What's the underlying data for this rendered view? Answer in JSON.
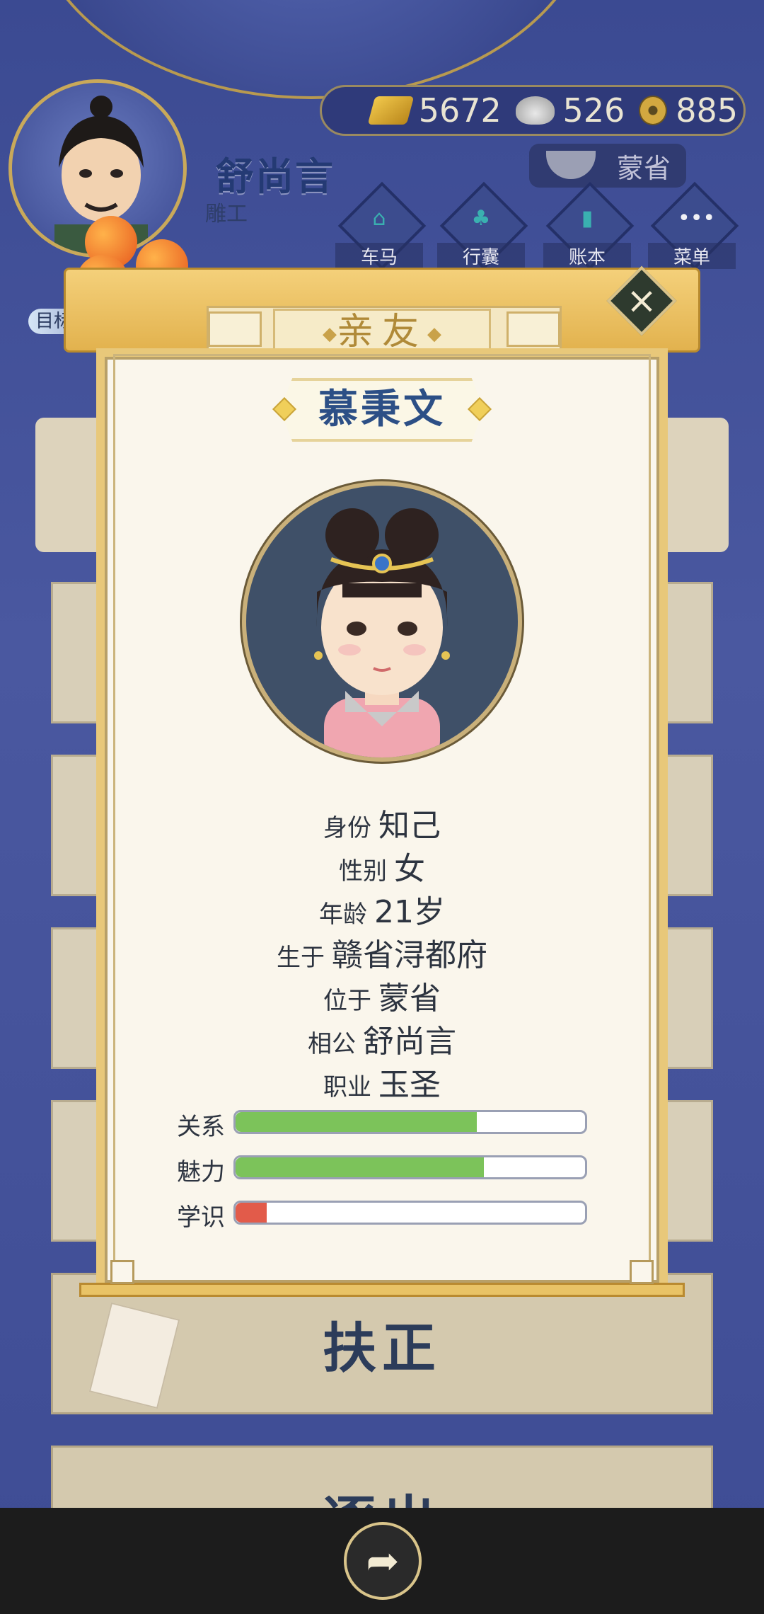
{
  "player": {
    "name": "舒尚言",
    "job": "雕工",
    "goal_label": "目标"
  },
  "resources": {
    "gold": "5672",
    "silver": "526",
    "coins": "885"
  },
  "location": {
    "label": "蒙省"
  },
  "menu": [
    {
      "label": "车马",
      "icon": "carriage-icon"
    },
    {
      "label": "行囊",
      "icon": "bundle-icon"
    },
    {
      "label": "账本",
      "icon": "ledger-icon"
    },
    {
      "label": "菜单",
      "icon": "more-icon"
    }
  ],
  "dialog": {
    "title": "亲友",
    "name": "慕秉文",
    "info": [
      {
        "key": "身份",
        "value": "知己"
      },
      {
        "key": "性别",
        "value": "女"
      },
      {
        "key": "年龄",
        "value": "21岁"
      },
      {
        "key": "生于",
        "value": "赣省浔都府"
      },
      {
        "key": "位于",
        "value": "蒙省"
      },
      {
        "key": "相公",
        "value": "舒尚言"
      },
      {
        "key": "职业",
        "value": "玉圣"
      }
    ],
    "stats": [
      {
        "label": "关系",
        "fraction": 0.69,
        "color": "#7cc35a"
      },
      {
        "label": "魅力",
        "fraction": 0.71,
        "color": "#7cc35a"
      },
      {
        "label": "学识",
        "fraction": 0.09,
        "color": "#e25b4a"
      }
    ]
  },
  "actions": {
    "primary": "扶正",
    "secondary": "逐出"
  },
  "colors": {
    "accent_gold": "#e8c87a",
    "name_blue": "#2c4f86",
    "bar_green": "#7cc35a",
    "bar_red": "#e25b4a"
  }
}
